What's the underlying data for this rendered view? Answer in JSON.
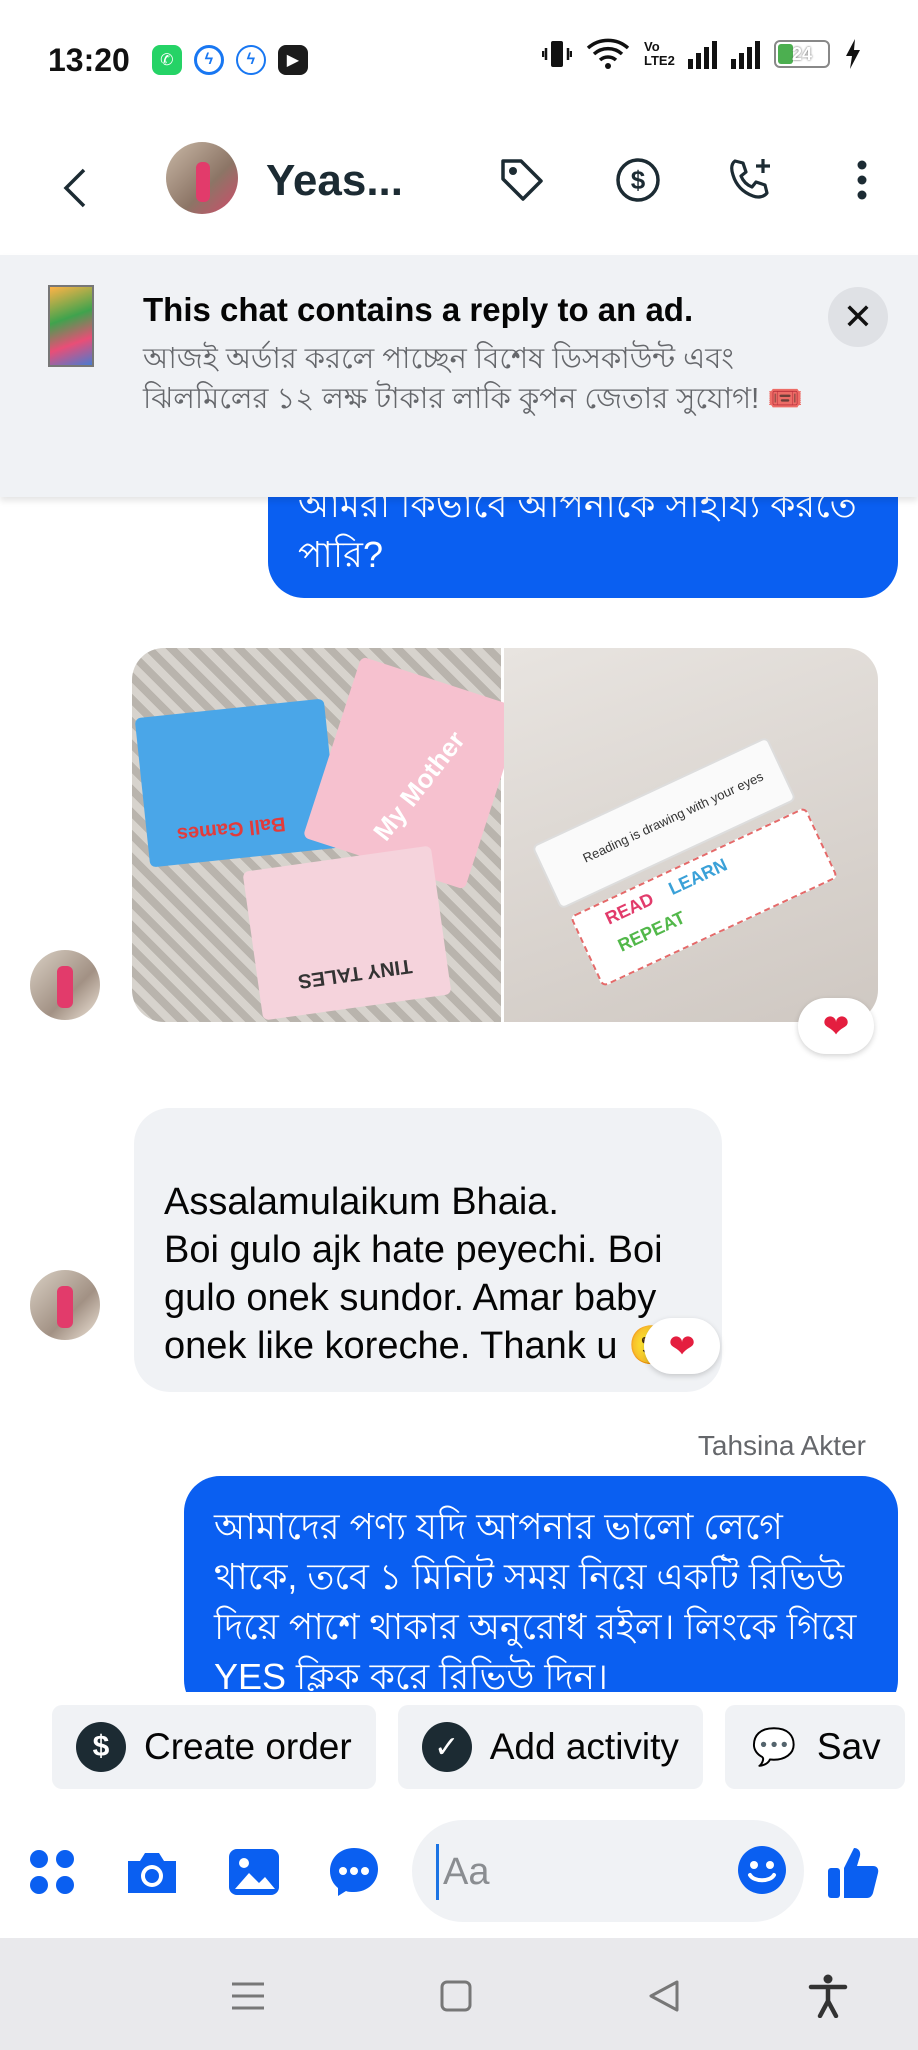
{
  "status_bar": {
    "time": "13:20",
    "apps": [
      {
        "icon": "whatsapp-icon",
        "color": "#25d366"
      },
      {
        "icon": "messenger-icon",
        "color": "#1877f2"
      },
      {
        "icon": "messenger-outline-icon",
        "color": "#1877f2"
      },
      {
        "icon": "media-app-icon",
        "color": "#1c1c1c"
      }
    ],
    "volte": "Vo LTE2",
    "battery": "24"
  },
  "header": {
    "contact_name": "Yeas...",
    "icons": [
      "back-arrow-icon",
      "tag-icon",
      "dollar-icon",
      "call-add-icon",
      "more-vertical-icon"
    ]
  },
  "ad_banner": {
    "title": "This chat contains a reply to an ad.",
    "text": "আজই অর্ডার করলে পাচ্ছেন বিশেষ ডিসকাউন্ট এবং ঝিলমিলের ১২ লক্ষ টাকার লাকি কুপন জেতার সুযোগ! 🎟️",
    "close": "✕"
  },
  "messages": {
    "outgoing_1": "আমরা কিভাবে আপনাকে সাহায্য করতে পারি?",
    "incoming_text": "Assalamulaikum Bhaia.\nBoi gulo ajk hate peyechi. Boi gulo onek sundor. Amar baby onek like koreche. Thank u 🙂",
    "reaction": "❤",
    "sender_name": "Tahsina Akter",
    "outgoing_2": "আমাদের পণ্য যদি আপনার ভালো লেগে থাকে, তবে ১ মিনিট সময় নিয়ে একটি রিভিউ দিয়ে পাশে থাকার অনুরোধ রইল। লিংকে গিয়ে YES ক্লিক করে রিভিউ দিন।",
    "photo_1_texts": {
      "ball": "Ball Games",
      "mother": "My Mother",
      "tales": "TINY TALES"
    },
    "photo_2_texts": {
      "read": "READ",
      "learn": "LEARN",
      "repeat": "REPEAT",
      "note": "Reading is drawing with your eyes"
    }
  },
  "quick_actions": [
    {
      "label": "Create order",
      "icon": "$"
    },
    {
      "label": "Add activity",
      "icon": "✓"
    },
    {
      "label": "Sav",
      "icon": "💬"
    }
  ],
  "composer": {
    "placeholder": "Aa",
    "icons": [
      "apps-grid-icon",
      "camera-icon",
      "gallery-icon",
      "chat-dots-icon",
      "emoji-icon",
      "like-thumb-icon"
    ]
  },
  "nav": {
    "icons": [
      "recents-menu-icon",
      "home-square-icon",
      "back-triangle-icon",
      "accessibility-icon"
    ]
  },
  "colors": {
    "brand_blue": "#0a5ff1",
    "bubble_gray": "#f0f2f5",
    "reaction_red": "#e41e3f"
  }
}
